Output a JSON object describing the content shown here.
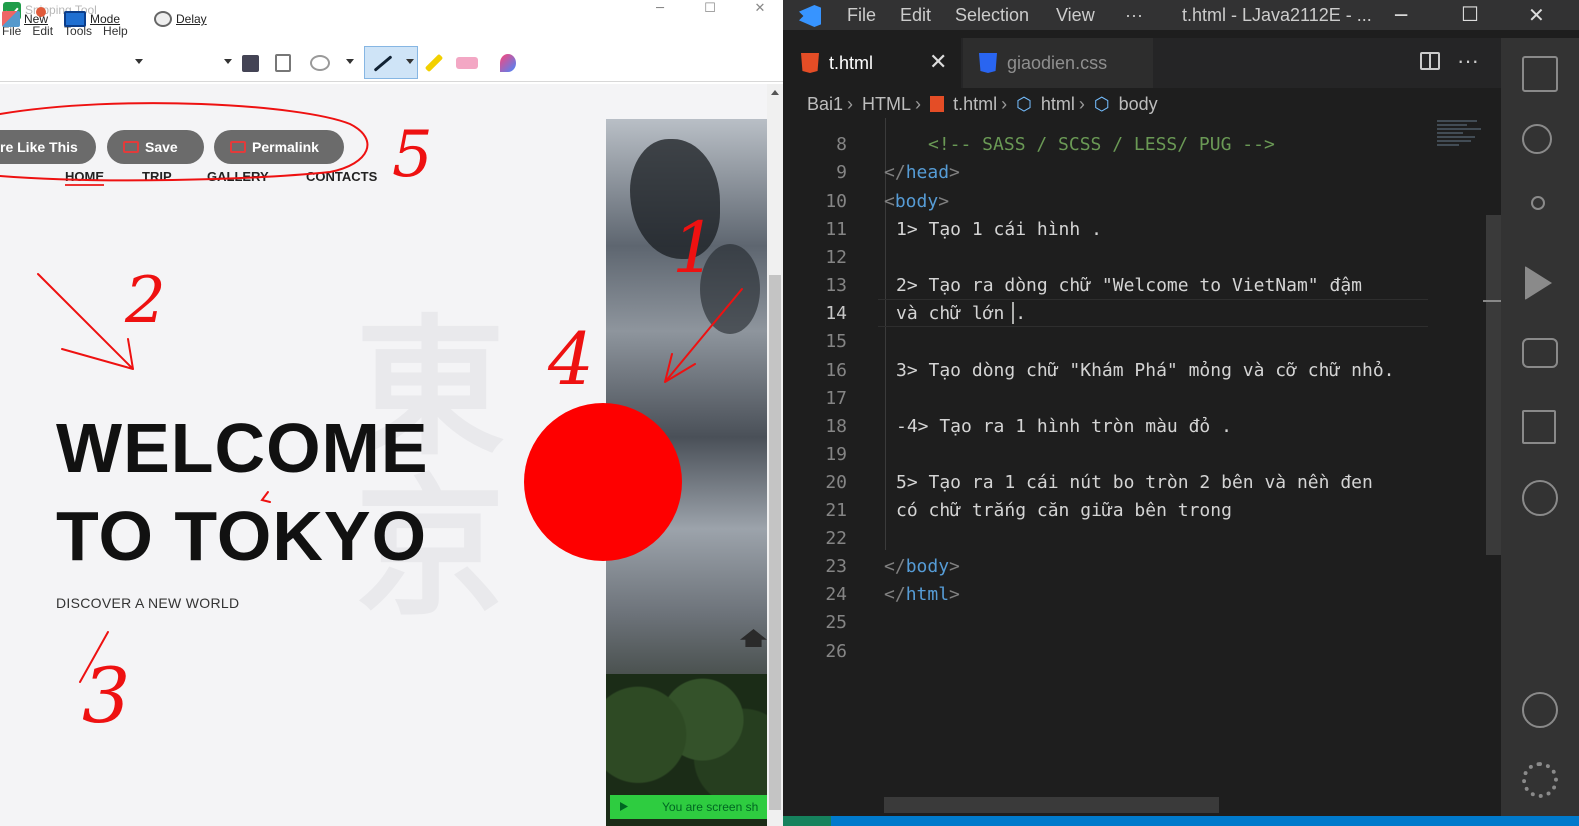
{
  "snipping_tool": {
    "title": "Snipping Tool",
    "menu": [
      "File",
      "Edit",
      "Tools",
      "Help"
    ],
    "toolbar": {
      "new": "New",
      "mode": "Mode",
      "delay": "Delay"
    },
    "webpage": {
      "pills": {
        "like": "re Like This",
        "save": "Save",
        "permalink": "Permalink"
      },
      "nav": {
        "home": "HOME",
        "trip": "TRIP",
        "gallery": "GALLERY",
        "contacts": "CONTACTS"
      },
      "kanji": "東京",
      "heading_line1": "WELCOME",
      "heading_line2": "TO TOKYO",
      "subheading": "DISCOVER A NEW WORLD",
      "banner": "You are screen sh",
      "annotations": {
        "n1": "1",
        "n2": "2",
        "n3": "3",
        "n4": "4",
        "n5": "5"
      }
    }
  },
  "vscode": {
    "menu": {
      "file": "File",
      "edit": "Edit",
      "selection": "Selection",
      "view": "View",
      "more": "···"
    },
    "window_title": "t.html - LJava2112E - ...",
    "tabs": [
      {
        "label": "t.html",
        "active": true
      },
      {
        "label": "giaodien.css",
        "active": false
      }
    ],
    "breadcrumb": [
      "Bai1",
      "HTML",
      "t.html",
      "html",
      "body"
    ],
    "lines": {
      "l8": {
        "num": "8",
        "text": "<!-- SASS / SCSS / LESS/ PUG -->"
      },
      "l9": {
        "num": "9",
        "text": "head"
      },
      "l10": {
        "num": "10",
        "text": "body"
      },
      "l11": {
        "num": "11",
        "text": "1> Tạo 1 cái hình ."
      },
      "l12": {
        "num": "12",
        "text": ""
      },
      "l13": {
        "num": "13",
        "text": "2> Tạo ra dòng chữ \"Welcome to VietNam\" đậm"
      },
      "l14": {
        "num": "14",
        "text": "và chữ lớn ."
      },
      "l15": {
        "num": "15",
        "text": ""
      },
      "l16": {
        "num": "16",
        "text": "3> Tạo dòng chữ \"Khám Phá\" mỏng và cỡ chữ nhỏ."
      },
      "l17": {
        "num": "17",
        "text": ""
      },
      "l18": {
        "num": "18",
        "text": "-4> Tạo ra 1 hình tròn màu đỏ ."
      },
      "l19": {
        "num": "19",
        "text": ""
      },
      "l20": {
        "num": "20",
        "text": "5> Tạo ra 1 cái nút bo tròn 2 bên và nền đen"
      },
      "l21": {
        "num": "21",
        "text": "có chữ trắng căn giữa bên trong"
      },
      "l22": {
        "num": "22",
        "text": ""
      },
      "l23": {
        "num": "23",
        "text": "body"
      },
      "l24": {
        "num": "24",
        "text": "html"
      },
      "l25": {
        "num": "25",
        "text": ""
      },
      "l26": {
        "num": "26",
        "text": ""
      }
    }
  },
  "colors": {
    "accent_red": "#fe0000",
    "vscode_bg": "#1e1e1e",
    "status_blue": "#007acc"
  }
}
